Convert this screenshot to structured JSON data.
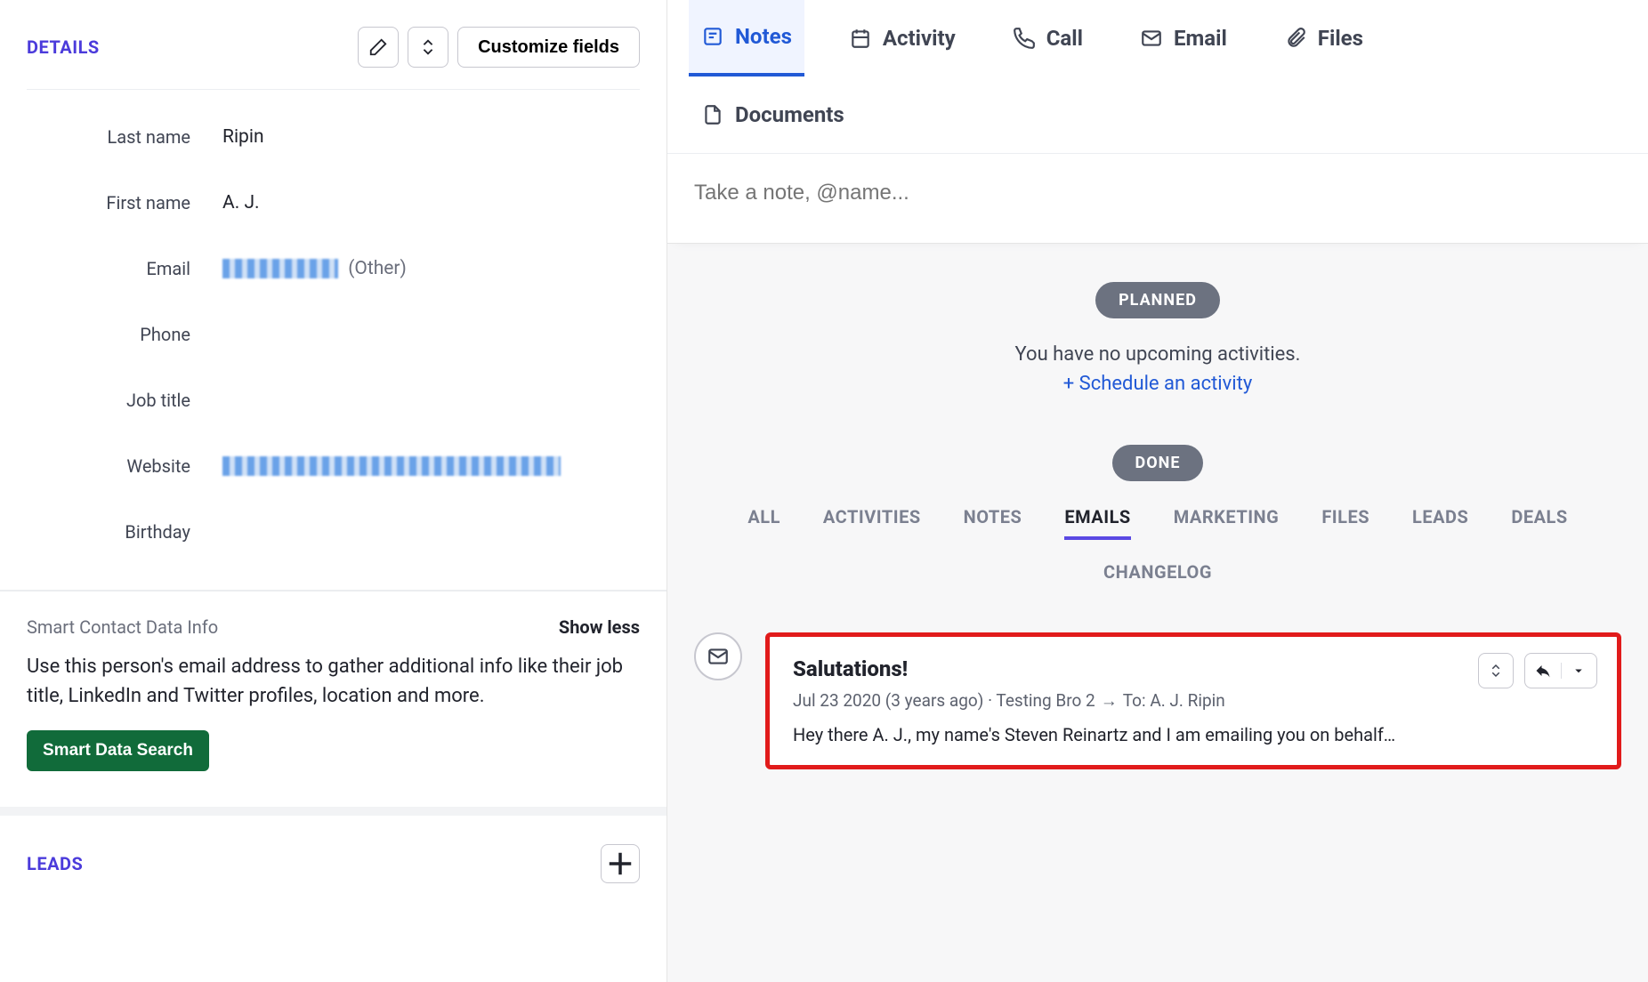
{
  "details": {
    "title": "DETAILS",
    "customize_label": "Customize fields",
    "fields": {
      "last_name_label": "Last name",
      "last_name_value": "Ripin",
      "first_name_label": "First name",
      "first_name_value": "A. J.",
      "email_label": "Email",
      "email_type": "(Other)",
      "phone_label": "Phone",
      "job_title_label": "Job title",
      "website_label": "Website",
      "birthday_label": "Birthday"
    }
  },
  "smart": {
    "title": "Smart Contact Data Info",
    "toggle": "Show less",
    "description": "Use this person's email address to gather additional info like their job title, LinkedIn and Twitter profiles, location and more.",
    "button": "Smart Data Search"
  },
  "leads": {
    "title": "LEADS"
  },
  "tabs": {
    "notes": "Notes",
    "activity": "Activity",
    "call": "Call",
    "email": "Email",
    "files": "Files",
    "documents": "Documents"
  },
  "note_placeholder": "Take a note, @name...",
  "planned": {
    "pill": "PLANNED",
    "empty": "You have no upcoming activities.",
    "schedule": "+ Schedule an activity"
  },
  "done": {
    "pill": "DONE",
    "filters": {
      "all": "ALL",
      "activities": "ACTIVITIES",
      "notes": "NOTES",
      "emails": "EMAILS",
      "marketing": "MARKETING",
      "files": "FILES",
      "leads": "LEADS",
      "deals": "DEALS",
      "changelog": "CHANGELOG"
    }
  },
  "email_entry": {
    "subject": "Salutations!",
    "date": "Jul 23 2020 (3 years ago)",
    "from": "Testing Bro 2",
    "to_label": "To:",
    "to": "A. J. Ripin",
    "preview": "Hey there A. J., my name's Steven Reinartz and I am emailing you on behalf…"
  }
}
